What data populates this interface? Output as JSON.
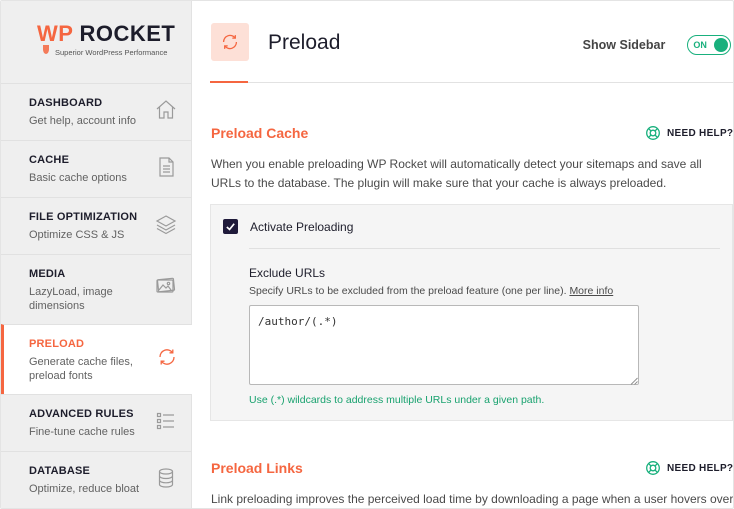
{
  "brand": {
    "wp": "WP",
    "rocket": "ROCKET",
    "tagline": "Superior WordPress Performance"
  },
  "sidebar": {
    "items": [
      {
        "title": "DASHBOARD",
        "subtitle": "Get help, account info",
        "icon": "home-icon"
      },
      {
        "title": "CACHE",
        "subtitle": "Basic cache options",
        "icon": "document-icon"
      },
      {
        "title": "FILE OPTIMIZATION",
        "subtitle": "Optimize CSS & JS",
        "icon": "layers-icon"
      },
      {
        "title": "MEDIA",
        "subtitle": "LazyLoad, image dimensions",
        "icon": "images-icon"
      },
      {
        "title": "PRELOAD",
        "subtitle": "Generate cache files, preload fonts",
        "icon": "refresh-icon",
        "active": true
      },
      {
        "title": "ADVANCED RULES",
        "subtitle": "Fine-tune cache rules",
        "icon": "list-icon"
      },
      {
        "title": "DATABASE",
        "subtitle": "Optimize, reduce bloat",
        "icon": "database-icon"
      }
    ]
  },
  "header": {
    "title": "Preload",
    "show_sidebar_label": "Show Sidebar",
    "toggle_label": "ON"
  },
  "preload_cache": {
    "title": "Preload Cache",
    "help_label": "NEED HELP?",
    "description": "When you enable preloading WP Rocket will automatically detect your sitemaps and save all URLs to the database. The plugin will make sure that your cache is always preloaded.",
    "checkbox_label": "Activate Preloading",
    "checkbox_checked": true,
    "exclude_title": "Exclude URLs",
    "exclude_desc": "Specify URLs to be excluded from the preload feature (one per line).",
    "more_info": "More info",
    "textarea_value": "/author/(.*)",
    "hint": "Use (.*) wildcards to address multiple URLs under a given path."
  },
  "preload_links": {
    "title": "Preload Links",
    "help_label": "NEED HELP?",
    "description": "Link preloading improves the perceived load time by downloading a page when a user hovers over"
  },
  "colors": {
    "accent": "#f56640",
    "success": "#19b07d",
    "dark": "#1f1a3a"
  }
}
